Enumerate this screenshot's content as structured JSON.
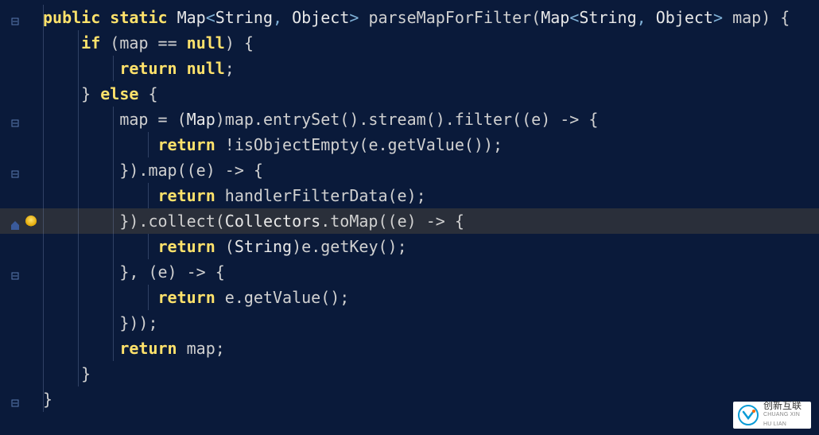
{
  "code": {
    "indent": "    ",
    "lines": [
      {
        "indent": 0,
        "segs": [
          {
            "c": "kw",
            "t": "public"
          },
          {
            "c": "pn",
            "t": " "
          },
          {
            "c": "kw",
            "t": "static"
          },
          {
            "c": "pn",
            "t": " "
          },
          {
            "c": "typ",
            "t": "Map"
          },
          {
            "c": "gen",
            "t": "<"
          },
          {
            "c": "typ",
            "t": "String"
          },
          {
            "c": "gen",
            "t": ", "
          },
          {
            "c": "typ",
            "t": "Object"
          },
          {
            "c": "gen",
            "t": ">"
          },
          {
            "c": "pn",
            "t": " "
          },
          {
            "c": "id",
            "t": "parseMapForFilter"
          },
          {
            "c": "pn",
            "t": "("
          },
          {
            "c": "typ",
            "t": "Map"
          },
          {
            "c": "gen",
            "t": "<"
          },
          {
            "c": "typ",
            "t": "String"
          },
          {
            "c": "gen",
            "t": ", "
          },
          {
            "c": "typ",
            "t": "Object"
          },
          {
            "c": "gen",
            "t": ">"
          },
          {
            "c": "pn",
            "t": " "
          },
          {
            "c": "id",
            "t": "map"
          },
          {
            "c": "pn",
            "t": ") {"
          }
        ]
      },
      {
        "indent": 1,
        "segs": [
          {
            "c": "kw",
            "t": "if"
          },
          {
            "c": "pn",
            "t": " ("
          },
          {
            "c": "id",
            "t": "map"
          },
          {
            "c": "pn",
            "t": " == "
          },
          {
            "c": "kw",
            "t": "null"
          },
          {
            "c": "pn",
            "t": ") {"
          }
        ]
      },
      {
        "indent": 2,
        "segs": [
          {
            "c": "kw",
            "t": "return"
          },
          {
            "c": "pn",
            "t": " "
          },
          {
            "c": "kw",
            "t": "null"
          },
          {
            "c": "pn",
            "t": ";"
          }
        ]
      },
      {
        "indent": 1,
        "segs": [
          {
            "c": "pn",
            "t": "} "
          },
          {
            "c": "kw",
            "t": "else"
          },
          {
            "c": "pn",
            "t": " {"
          }
        ]
      },
      {
        "indent": 2,
        "segs": [
          {
            "c": "id",
            "t": "map"
          },
          {
            "c": "pn",
            "t": " = ("
          },
          {
            "c": "typ",
            "t": "Map"
          },
          {
            "c": "pn",
            "t": ")"
          },
          {
            "c": "id",
            "t": "map"
          },
          {
            "c": "pn",
            "t": "."
          },
          {
            "c": "fn",
            "t": "entrySet"
          },
          {
            "c": "pn",
            "t": "()."
          },
          {
            "c": "fn",
            "t": "stream"
          },
          {
            "c": "pn",
            "t": "()."
          },
          {
            "c": "fn",
            "t": "filter"
          },
          {
            "c": "pn",
            "t": "(("
          },
          {
            "c": "id",
            "t": "e"
          },
          {
            "c": "pn",
            "t": ") -> {"
          }
        ]
      },
      {
        "indent": 3,
        "segs": [
          {
            "c": "kw",
            "t": "return"
          },
          {
            "c": "pn",
            "t": " !"
          },
          {
            "c": "fn",
            "t": "isObjectEmpty"
          },
          {
            "c": "pn",
            "t": "("
          },
          {
            "c": "id",
            "t": "e"
          },
          {
            "c": "pn",
            "t": "."
          },
          {
            "c": "fn",
            "t": "getValue"
          },
          {
            "c": "pn",
            "t": "());"
          }
        ]
      },
      {
        "indent": 2,
        "segs": [
          {
            "c": "pn",
            "t": "})."
          },
          {
            "c": "fn",
            "t": "map"
          },
          {
            "c": "pn",
            "t": "(("
          },
          {
            "c": "id",
            "t": "e"
          },
          {
            "c": "pn",
            "t": ") -> {"
          }
        ]
      },
      {
        "indent": 3,
        "segs": [
          {
            "c": "kw",
            "t": "return"
          },
          {
            "c": "pn",
            "t": " "
          },
          {
            "c": "fn",
            "t": "handlerFilterData"
          },
          {
            "c": "pn",
            "t": "("
          },
          {
            "c": "id",
            "t": "e"
          },
          {
            "c": "pn",
            "t": ");"
          }
        ]
      },
      {
        "indent": 2,
        "hl": true,
        "segs": [
          {
            "c": "pn",
            "t": "})."
          },
          {
            "c": "fn",
            "t": "collect"
          },
          {
            "c": "pn",
            "t": "("
          },
          {
            "c": "typ",
            "t": "Collectors"
          },
          {
            "c": "pn",
            "t": "."
          },
          {
            "c": "fn",
            "t": "toMap"
          },
          {
            "c": "pn",
            "t": "(("
          },
          {
            "c": "id",
            "t": "e"
          },
          {
            "c": "pn",
            "t": ") -> {"
          }
        ]
      },
      {
        "indent": 3,
        "segs": [
          {
            "c": "kw",
            "t": "return"
          },
          {
            "c": "pn",
            "t": " ("
          },
          {
            "c": "typ",
            "t": "String"
          },
          {
            "c": "pn",
            "t": ")"
          },
          {
            "c": "id",
            "t": "e"
          },
          {
            "c": "pn",
            "t": "."
          },
          {
            "c": "fn",
            "t": "getKey"
          },
          {
            "c": "pn",
            "t": "();"
          }
        ]
      },
      {
        "indent": 2,
        "segs": [
          {
            "c": "pn",
            "t": "}, ("
          },
          {
            "c": "id",
            "t": "e"
          },
          {
            "c": "pn",
            "t": ") -> {"
          }
        ]
      },
      {
        "indent": 3,
        "segs": [
          {
            "c": "kw",
            "t": "return"
          },
          {
            "c": "pn",
            "t": " "
          },
          {
            "c": "id",
            "t": "e"
          },
          {
            "c": "pn",
            "t": "."
          },
          {
            "c": "fn",
            "t": "getValue"
          },
          {
            "c": "pn",
            "t": "();"
          }
        ]
      },
      {
        "indent": 2,
        "segs": [
          {
            "c": "pn",
            "t": "}));"
          }
        ]
      },
      {
        "indent": 2,
        "segs": [
          {
            "c": "kw",
            "t": "return"
          },
          {
            "c": "pn",
            "t": " "
          },
          {
            "c": "id",
            "t": "map"
          },
          {
            "c": "pn",
            "t": ";"
          }
        ]
      },
      {
        "indent": 1,
        "segs": [
          {
            "c": "pn",
            "t": "}"
          }
        ]
      },
      {
        "indent": 0,
        "segs": [
          {
            "c": "pn",
            "t": "}"
          }
        ]
      }
    ]
  },
  "gutter": {
    "icons": [
      {
        "line": 0,
        "kind": "fold"
      },
      {
        "line": 4,
        "kind": "fold"
      },
      {
        "line": 6,
        "kind": "fold"
      },
      {
        "line": 8,
        "kind": "home"
      },
      {
        "line": 8,
        "kind": "bulb"
      },
      {
        "line": 10,
        "kind": "fold"
      },
      {
        "line": 15,
        "kind": "fold"
      }
    ]
  },
  "watermark": {
    "brand_cn": "创新互联",
    "brand_en": "CHUANG XIN HU LIAN"
  }
}
